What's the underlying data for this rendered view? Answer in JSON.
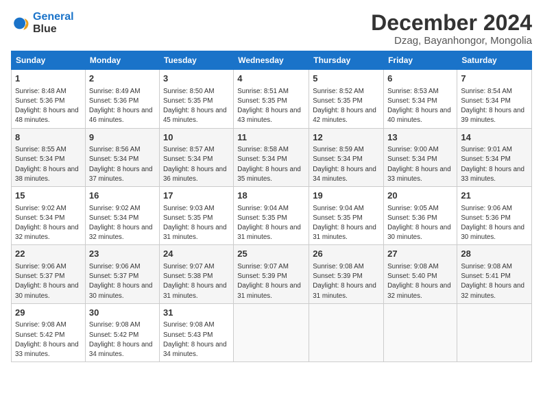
{
  "logo": {
    "line1": "General",
    "line2": "Blue"
  },
  "title": "December 2024",
  "subtitle": "Dzag, Bayanhongor, Mongolia",
  "days_of_week": [
    "Sunday",
    "Monday",
    "Tuesday",
    "Wednesday",
    "Thursday",
    "Friday",
    "Saturday"
  ],
  "weeks": [
    [
      {
        "day": "1",
        "sunrise": "8:48 AM",
        "sunset": "5:36 PM",
        "daylight": "8 hours and 48 minutes."
      },
      {
        "day": "2",
        "sunrise": "8:49 AM",
        "sunset": "5:36 PM",
        "daylight": "8 hours and 46 minutes."
      },
      {
        "day": "3",
        "sunrise": "8:50 AM",
        "sunset": "5:35 PM",
        "daylight": "8 hours and 45 minutes."
      },
      {
        "day": "4",
        "sunrise": "8:51 AM",
        "sunset": "5:35 PM",
        "daylight": "8 hours and 43 minutes."
      },
      {
        "day": "5",
        "sunrise": "8:52 AM",
        "sunset": "5:35 PM",
        "daylight": "8 hours and 42 minutes."
      },
      {
        "day": "6",
        "sunrise": "8:53 AM",
        "sunset": "5:34 PM",
        "daylight": "8 hours and 40 minutes."
      },
      {
        "day": "7",
        "sunrise": "8:54 AM",
        "sunset": "5:34 PM",
        "daylight": "8 hours and 39 minutes."
      }
    ],
    [
      {
        "day": "8",
        "sunrise": "8:55 AM",
        "sunset": "5:34 PM",
        "daylight": "8 hours and 38 minutes."
      },
      {
        "day": "9",
        "sunrise": "8:56 AM",
        "sunset": "5:34 PM",
        "daylight": "8 hours and 37 minutes."
      },
      {
        "day": "10",
        "sunrise": "8:57 AM",
        "sunset": "5:34 PM",
        "daylight": "8 hours and 36 minutes."
      },
      {
        "day": "11",
        "sunrise": "8:58 AM",
        "sunset": "5:34 PM",
        "daylight": "8 hours and 35 minutes."
      },
      {
        "day": "12",
        "sunrise": "8:59 AM",
        "sunset": "5:34 PM",
        "daylight": "8 hours and 34 minutes."
      },
      {
        "day": "13",
        "sunrise": "9:00 AM",
        "sunset": "5:34 PM",
        "daylight": "8 hours and 33 minutes."
      },
      {
        "day": "14",
        "sunrise": "9:01 AM",
        "sunset": "5:34 PM",
        "daylight": "8 hours and 33 minutes."
      }
    ],
    [
      {
        "day": "15",
        "sunrise": "9:02 AM",
        "sunset": "5:34 PM",
        "daylight": "8 hours and 32 minutes."
      },
      {
        "day": "16",
        "sunrise": "9:02 AM",
        "sunset": "5:34 PM",
        "daylight": "8 hours and 32 minutes."
      },
      {
        "day": "17",
        "sunrise": "9:03 AM",
        "sunset": "5:35 PM",
        "daylight": "8 hours and 31 minutes."
      },
      {
        "day": "18",
        "sunrise": "9:04 AM",
        "sunset": "5:35 PM",
        "daylight": "8 hours and 31 minutes."
      },
      {
        "day": "19",
        "sunrise": "9:04 AM",
        "sunset": "5:35 PM",
        "daylight": "8 hours and 31 minutes."
      },
      {
        "day": "20",
        "sunrise": "9:05 AM",
        "sunset": "5:36 PM",
        "daylight": "8 hours and 30 minutes."
      },
      {
        "day": "21",
        "sunrise": "9:06 AM",
        "sunset": "5:36 PM",
        "daylight": "8 hours and 30 minutes."
      }
    ],
    [
      {
        "day": "22",
        "sunrise": "9:06 AM",
        "sunset": "5:37 PM",
        "daylight": "8 hours and 30 minutes."
      },
      {
        "day": "23",
        "sunrise": "9:06 AM",
        "sunset": "5:37 PM",
        "daylight": "8 hours and 30 minutes."
      },
      {
        "day": "24",
        "sunrise": "9:07 AM",
        "sunset": "5:38 PM",
        "daylight": "8 hours and 31 minutes."
      },
      {
        "day": "25",
        "sunrise": "9:07 AM",
        "sunset": "5:39 PM",
        "daylight": "8 hours and 31 minutes."
      },
      {
        "day": "26",
        "sunrise": "9:08 AM",
        "sunset": "5:39 PM",
        "daylight": "8 hours and 31 minutes."
      },
      {
        "day": "27",
        "sunrise": "9:08 AM",
        "sunset": "5:40 PM",
        "daylight": "8 hours and 32 minutes."
      },
      {
        "day": "28",
        "sunrise": "9:08 AM",
        "sunset": "5:41 PM",
        "daylight": "8 hours and 32 minutes."
      }
    ],
    [
      {
        "day": "29",
        "sunrise": "9:08 AM",
        "sunset": "5:42 PM",
        "daylight": "8 hours and 33 minutes."
      },
      {
        "day": "30",
        "sunrise": "9:08 AM",
        "sunset": "5:42 PM",
        "daylight": "8 hours and 34 minutes."
      },
      {
        "day": "31",
        "sunrise": "9:08 AM",
        "sunset": "5:43 PM",
        "daylight": "8 hours and 34 minutes."
      },
      null,
      null,
      null,
      null
    ]
  ]
}
